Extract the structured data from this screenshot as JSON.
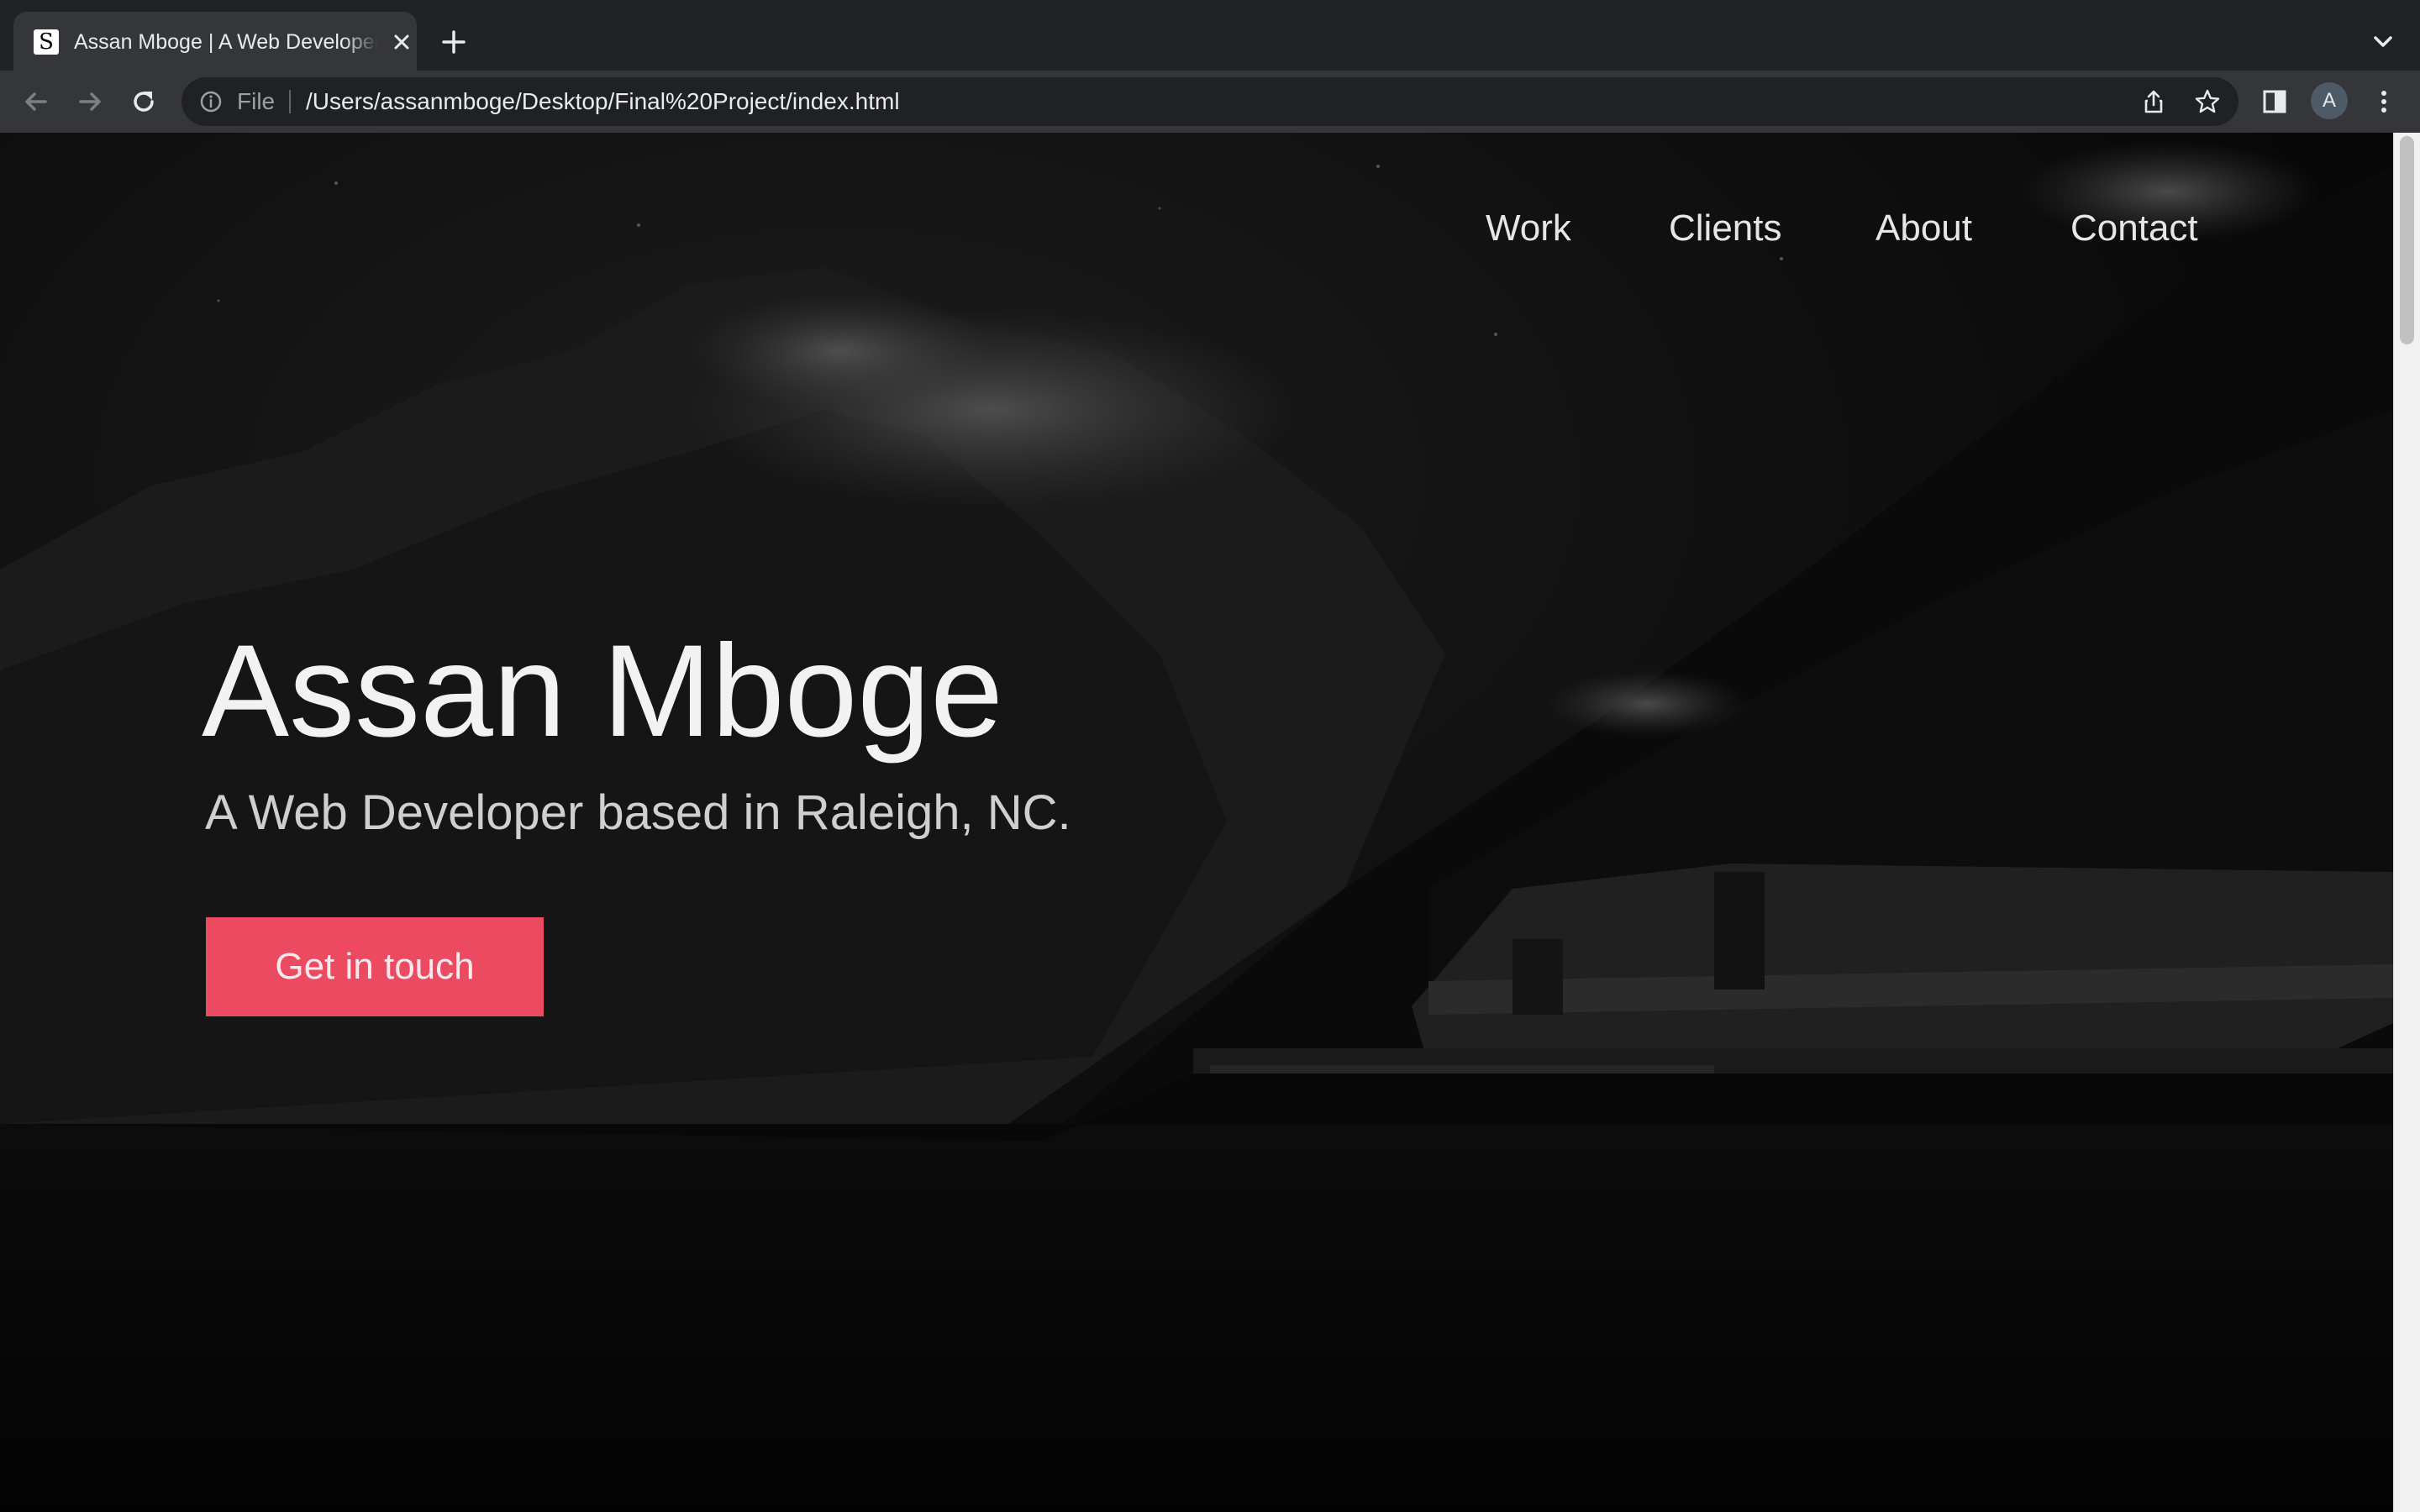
{
  "browser": {
    "tab": {
      "favicon_letter": "S",
      "title": "Assan Mboge | A Web Developer based in Raleigh, NC."
    },
    "address_bar": {
      "scheme_label": "File",
      "url": "/Users/assanmboge/Desktop/Final%20Project/index.html"
    },
    "profile_initial": "A",
    "colors": {
      "tabstrip": "#202124",
      "toolbar": "#35363a",
      "omnibox": "#202124",
      "text": "#e8eaed",
      "muted": "#9aa0a6"
    }
  },
  "site": {
    "nav": {
      "items": [
        {
          "label": "Work"
        },
        {
          "label": "Clients"
        },
        {
          "label": "About"
        },
        {
          "label": "Contact"
        }
      ]
    },
    "hero": {
      "name": "Assan Mboge",
      "tagline": "A Web Developer based in Raleigh, NC.",
      "cta_label": "Get in touch",
      "background": "dark mountain lake with boathouse (darkened photo)"
    },
    "colors": {
      "accent": "#ec4a61",
      "heading": "#f2f2f2",
      "subheading": "#cfcfcf",
      "background": "#060606"
    }
  }
}
